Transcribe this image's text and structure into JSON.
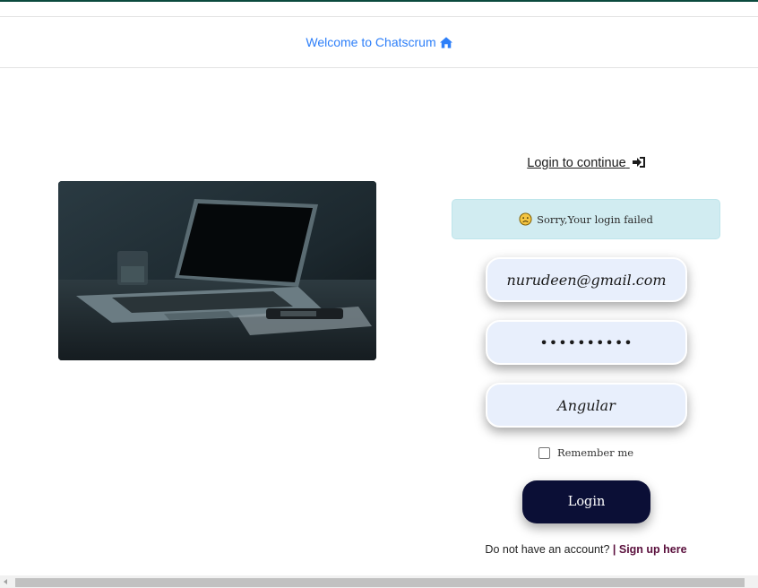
{
  "header": {
    "welcome_text": "Welcome to Chatscrum",
    "home_icon": "home-icon"
  },
  "login": {
    "heading": "Login to continue",
    "heading_icon": "sign-in-icon"
  },
  "alert": {
    "message": "Sorry,Your login failed",
    "icon": "sad-face-icon",
    "bg_color": "#d1ecf1"
  },
  "form": {
    "email_value": "nurudeen@gmail.com",
    "password_value": "••••••••••",
    "project_value": "Angular",
    "remember_label": "Remember me",
    "remember_checked": false,
    "login_label": "Login"
  },
  "signup": {
    "prompt": "Do not have an account?",
    "link_label": "| Sign up here"
  },
  "colors": {
    "accent_link": "#2d7ff9",
    "button_bg": "#0b0f36",
    "input_bg": "#e8effc",
    "signup_link": "#5a0f3c"
  }
}
